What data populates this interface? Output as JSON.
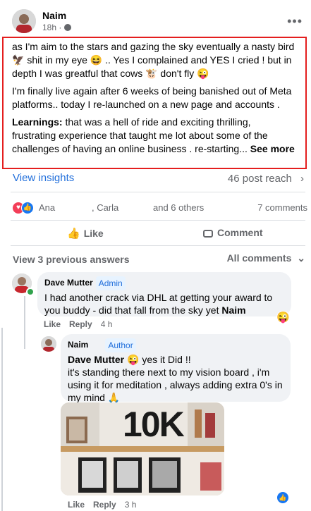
{
  "post": {
    "author": "Naim",
    "time": "18h ·",
    "paragraphs": [
      "as I'm aim to the stars and gazing the sky eventually a nasty bird 🦅 shit in my eye 😆 .. Yes I complained and YES I cried ! but in depth I was greatful that cows 🐮 don't fly 😜",
      "I'm finally live again after 6 weeks of being banished out of Meta platforms.. today I re-launched on a new page and accounts ."
    ],
    "learnings_label": "Learnings:",
    "learnings_text": " that was a hell of ride and exciting thrilling, frustrating experience that taught me lot about some of the challenges of having an online business . re-starting... ",
    "see_more": "See more"
  },
  "insights": {
    "label": "View insights",
    "reach": "46 post reach"
  },
  "reactions": {
    "names": [
      "Ana",
      ", Carla",
      "and 6 others"
    ],
    "comments": "7 comments"
  },
  "buttons": {
    "like": "Like",
    "comment": "Comment"
  },
  "comments_header": {
    "previous": "View 3 previous answers",
    "sort": "All comments"
  },
  "comment1": {
    "author": "Dave Mutter",
    "badge": "Admin",
    "text": "I had another crack via DHL at getting your award to you buddy - did that fall from the sky yet ",
    "mention": "Naim",
    "like": "Like",
    "reply": "Reply",
    "time": "4 h",
    "reaction_emoji": "😜"
  },
  "reply1": {
    "author": "Naim",
    "badge": "Author",
    "mention": "Dave Mutter",
    "text1": " 😜 yes it Did !!",
    "text2": "it's standing there next to my vision board , i'm using it for meditation , always adding extra 0's in my mind 🙏",
    "photo_text": "10K",
    "like": "Like",
    "reply": "Reply",
    "time": "3 h"
  },
  "colors": {
    "highlight": "#e41e1e",
    "link": "#216fdb",
    "bubble": "#f0f2f5"
  }
}
